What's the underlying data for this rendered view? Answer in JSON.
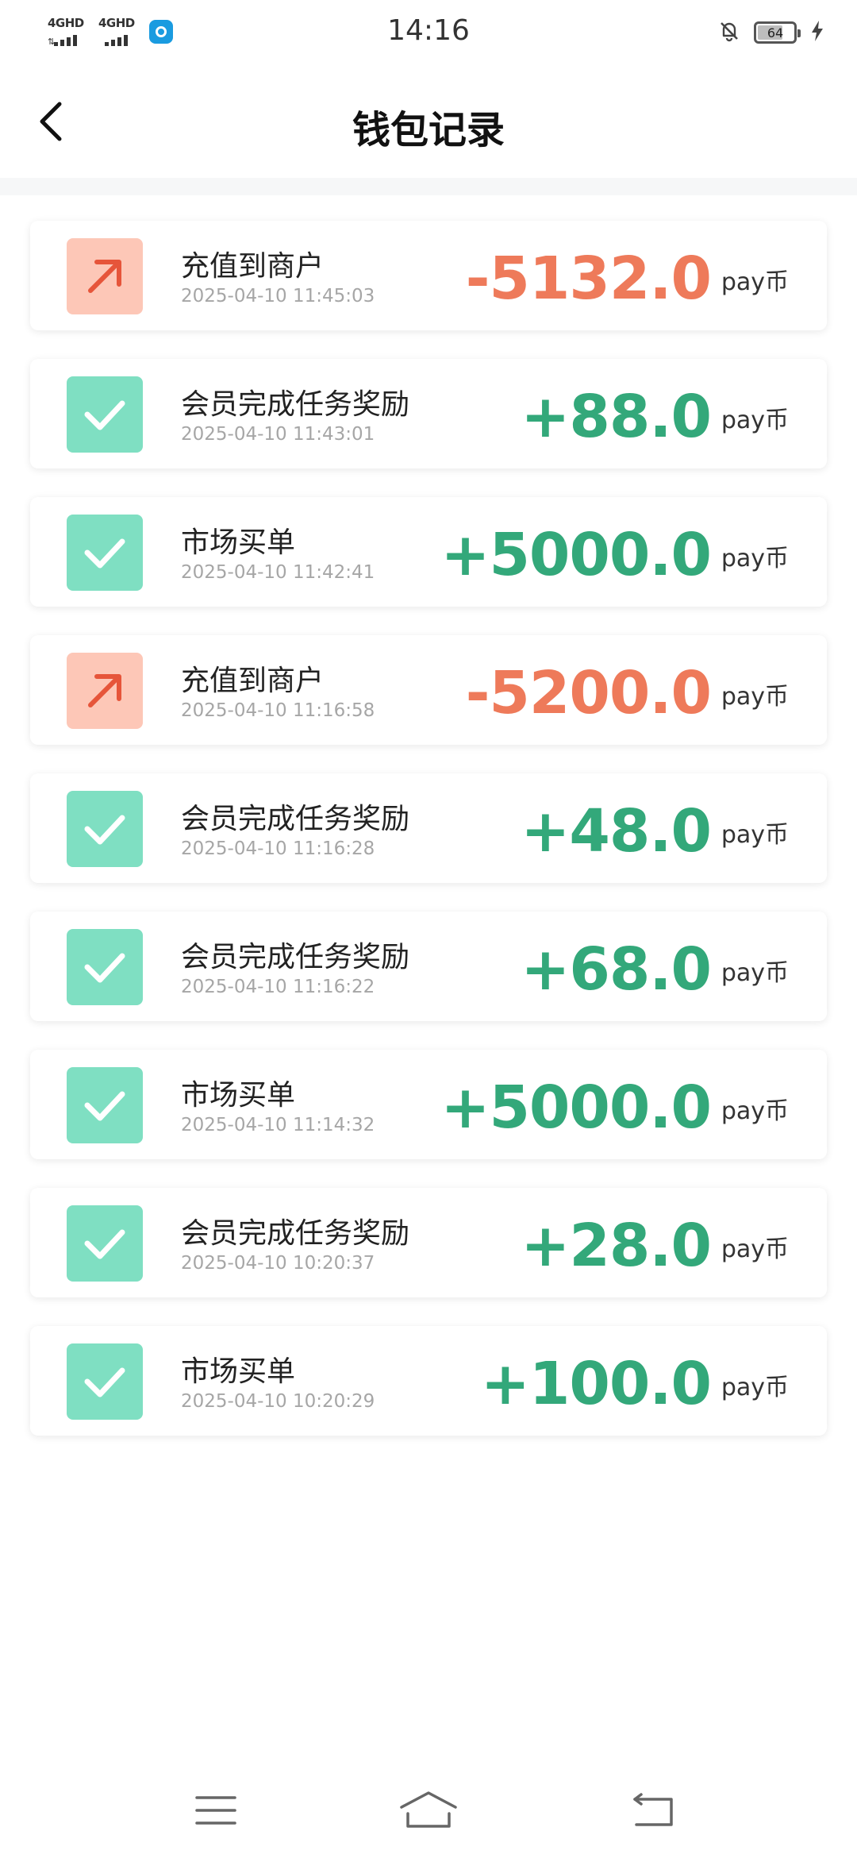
{
  "status_bar": {
    "signal_1": "4GHD",
    "signal_2": "4GHD",
    "time": "14:16",
    "battery_level": "64",
    "icons": [
      "signal-icon",
      "app-notification-icon",
      "mute-bell-icon",
      "battery-icon",
      "charging-icon"
    ]
  },
  "header": {
    "title": "钱包记录",
    "back_icon": "chevron-left-icon"
  },
  "colors": {
    "positive": "#33a87a",
    "negative": "#ee7a5a",
    "positive_icon_bg": "#7fdfc2",
    "negative_icon_bg": "#fdc7b7",
    "negative_icon_fg": "#e6553a"
  },
  "records": [
    {
      "type": "out",
      "icon": "arrow-up-right-icon",
      "title": "充值到商户",
      "time": "2025-04-10 11:45:03",
      "amount": "-5132.0",
      "unit": "pay币"
    },
    {
      "type": "in",
      "icon": "check-icon",
      "title": "会员完成任务奖励",
      "time": "2025-04-10 11:43:01",
      "amount": "+88.0",
      "unit": "pay币"
    },
    {
      "type": "in",
      "icon": "check-icon",
      "title": "市场买单",
      "time": "2025-04-10 11:42:41",
      "amount": "+5000.0",
      "unit": "pay币"
    },
    {
      "type": "out",
      "icon": "arrow-up-right-icon",
      "title": "充值到商户",
      "time": "2025-04-10 11:16:58",
      "amount": "-5200.0",
      "unit": "pay币"
    },
    {
      "type": "in",
      "icon": "check-icon",
      "title": "会员完成任务奖励",
      "time": "2025-04-10 11:16:28",
      "amount": "+48.0",
      "unit": "pay币"
    },
    {
      "type": "in",
      "icon": "check-icon",
      "title": "会员完成任务奖励",
      "time": "2025-04-10 11:16:22",
      "amount": "+68.0",
      "unit": "pay币"
    },
    {
      "type": "in",
      "icon": "check-icon",
      "title": "市场买单",
      "time": "2025-04-10 11:14:32",
      "amount": "+5000.0",
      "unit": "pay币"
    },
    {
      "type": "in",
      "icon": "check-icon",
      "title": "会员完成任务奖励",
      "time": "2025-04-10 10:20:37",
      "amount": "+28.0",
      "unit": "pay币"
    },
    {
      "type": "in",
      "icon": "check-icon",
      "title": "市场买单",
      "time": "2025-04-10 10:20:29",
      "amount": "+100.0",
      "unit": "pay币"
    }
  ],
  "nav_bar": {
    "icons": [
      "menu-icon",
      "home-icon",
      "back-icon"
    ]
  }
}
